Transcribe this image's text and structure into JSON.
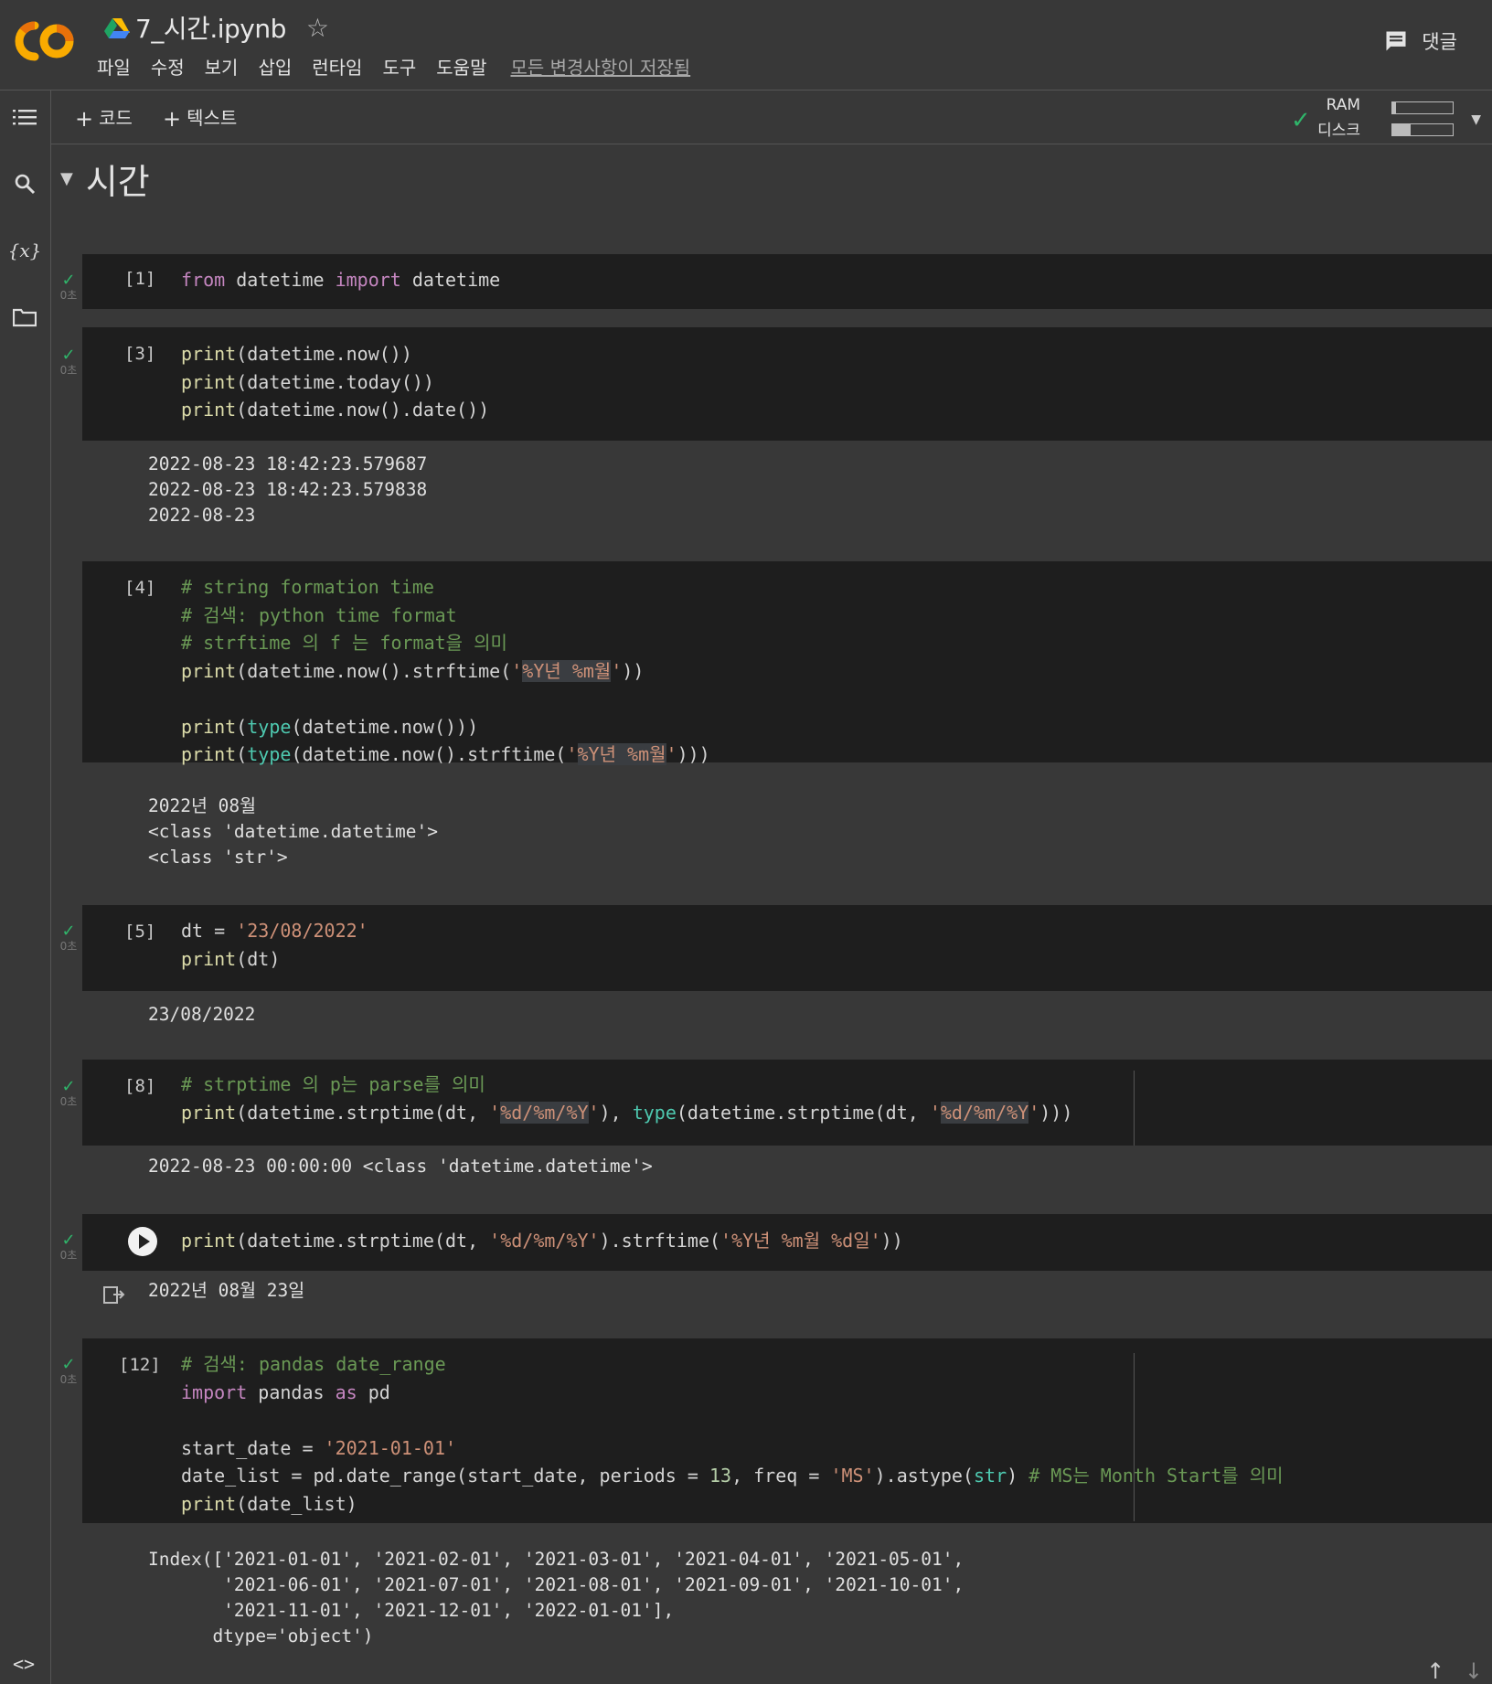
{
  "header": {
    "doc_title": "7_시간.ipynb",
    "star_label": "☆",
    "menu": [
      "파일",
      "수정",
      "보기",
      "삽입",
      "런타임",
      "도구",
      "도움말"
    ],
    "saved_status": "모든 변경사항이 저장됨",
    "comments_label": "댓글"
  },
  "toolbar": {
    "add_code_label": "코드",
    "add_text_label": "텍스트",
    "ram_label": "RAM",
    "disk_label": "디스크",
    "ram_usage": 0.06,
    "disk_usage": 0.3
  },
  "left_rail": {
    "icons": [
      "table-of-contents-icon",
      "search-icon",
      "variables-icon",
      "files-icon"
    ],
    "variables_glyph": "{x}",
    "code_snippets_glyph": "<>"
  },
  "section": {
    "title": "시간"
  },
  "cells": [
    {
      "number": "[1]",
      "status_time": "0초",
      "code": [
        "from datetime import datetime"
      ],
      "output": []
    },
    {
      "number": "[3]",
      "status_time": "0초",
      "code": [
        "print(datetime.now())",
        "print(datetime.today())",
        "print(datetime.now().date())"
      ],
      "output": [
        "2022-08-23 18:42:23.579687",
        "2022-08-23 18:42:23.579838",
        "2022-08-23"
      ]
    },
    {
      "number": "[4]",
      "status_time": "",
      "code": [
        "# string formation time",
        "# 검색: python time format",
        "# strftime 의 f 는 format을 의미",
        "print(datetime.now().strftime('%Y년 %m월'))",
        "",
        "print(type(datetime.now()))",
        "print(type(datetime.now().strftime('%Y년 %m월')))"
      ],
      "output": [
        "2022년 08월",
        "<class 'datetime.datetime'>",
        "<class 'str'>"
      ]
    },
    {
      "number": "[5]",
      "status_time": "0초",
      "code": [
        "dt = '23/08/2022'",
        "print(dt)"
      ],
      "output": [
        "23/08/2022"
      ]
    },
    {
      "number": "[8]",
      "status_time": "0초",
      "code": [
        "# strptime 의 p는 parse를 의미",
        "print(datetime.strptime(dt, '%d/%m/%Y'), type(datetime.strptime(dt, '%d/%m/%Y')))"
      ],
      "output": [
        "2022-08-23 00:00:00 <class 'datetime.datetime'>"
      ]
    },
    {
      "number": "",
      "status_time": "0초",
      "code": [
        "print(datetime.strptime(dt, '%d/%m/%Y').strftime('%Y년 %m월 %d일'))"
      ],
      "output": [
        "2022년 08월 23일"
      ]
    },
    {
      "number": "[12]",
      "status_time": "0초",
      "code": [
        "# 검색: pandas date_range",
        "import pandas as pd",
        "",
        "start_date = '2021-01-01'",
        "date_list = pd.date_range(start_date, periods = 13, freq = 'MS').astype(str) # MS는 Month Start를 의미",
        "print(date_list)"
      ],
      "output": [
        "Index(['2021-01-01', '2021-02-01', '2021-03-01', '2021-04-01', '2021-05-01',",
        "       '2021-06-01', '2021-07-01', '2021-08-01', '2021-09-01', '2021-10-01',",
        "       '2021-11-01', '2021-12-01', '2022-01-01'],",
        "      dtype='object')"
      ]
    }
  ]
}
